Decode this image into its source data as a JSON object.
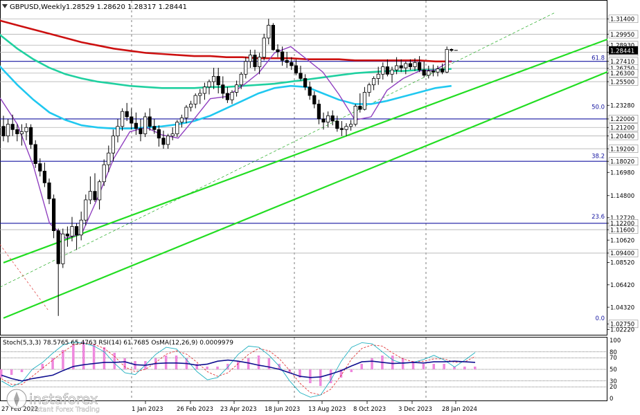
{
  "header": {
    "symbol": "GBPUSD,Weekly",
    "quote": "1.28529 1.28620 1.28317 1.28441"
  },
  "chart_data": {
    "type": "candlestick",
    "symbol": "GBPUSD",
    "timeframe": "Weekly",
    "price_axis_ticks": [
      "1.31400",
      "1.29950",
      "1.28930",
      "1.28270",
      "1.27410",
      "1.26750",
      "1.26300",
      "1.25500",
      "1.23280",
      "1.22000",
      "1.21200",
      "1.20400",
      "1.19200",
      "1.18020",
      "1.16980",
      "1.14800",
      "1.12720",
      "1.12200",
      "1.11600",
      "1.10620",
      "1.09400",
      "1.08520",
      "1.06420",
      "1.04320",
      "1.02750",
      "1.02220"
    ],
    "price_ylim": [
      1.0225,
      1.32
    ],
    "last_price": 1.28441,
    "time_axis_labels": [
      "27 Feb 2022",
      "1 Jan 2023",
      "26 Feb 2023",
      "23 Apr 2023",
      "18 Jun 2023",
      "13 Aug 2023",
      "8 Oct 2023",
      "3 Dec 2023",
      "28 Jan 2024"
    ],
    "horizontal_levels": [
      {
        "price": 1.314,
        "color": "#b0b0b0"
      },
      {
        "price": 1.2995,
        "color": "#b0b0b0"
      },
      {
        "price": 1.2893,
        "color": "#b0b0b0"
      },
      {
        "price": 1.2827,
        "color": "#b0b0b0"
      },
      {
        "price": 1.2741,
        "color": "#1515a0"
      },
      {
        "price": 1.2675,
        "color": "#b0b0b0"
      },
      {
        "price": 1.263,
        "color": "#b0b0b0"
      },
      {
        "price": 1.255,
        "color": "#b0b0b0"
      },
      {
        "price": 1.22,
        "color": "#1515a0"
      },
      {
        "price": 1.212,
        "color": "#b0b0b0"
      },
      {
        "price": 1.204,
        "color": "#b0b0b0"
      },
      {
        "price": 1.192,
        "color": "#b0b0b0"
      },
      {
        "price": 1.1802,
        "color": "#1515a0"
      },
      {
        "price": 1.122,
        "color": "#1515a0"
      },
      {
        "price": 1.116,
        "color": "#b0b0b0"
      },
      {
        "price": 1.094,
        "color": "#b0b0b0"
      }
    ],
    "fibonacci_labels": [
      {
        "label": "61.8",
        "price": 1.2741
      },
      {
        "label": "50.0",
        "price": 1.228
      },
      {
        "label": "38.2",
        "price": 1.182
      },
      {
        "label": "23.6",
        "price": 1.125
      },
      {
        "label": "0.0",
        "price": 1.0295
      }
    ],
    "moving_averages": [
      {
        "color": "#cc1010",
        "values": [
          1.316,
          1.312,
          1.308,
          1.304,
          1.3,
          1.296,
          1.292,
          1.289,
          1.286,
          1.284,
          1.282,
          1.281,
          1.28,
          1.279,
          1.279,
          1.278,
          1.278,
          1.277,
          1.277,
          1.277,
          1.276,
          1.276,
          1.276,
          1.275,
          1.275,
          1.275,
          1.275,
          1.275,
          1.274,
          1.274
        ]
      },
      {
        "color": "#20d0a0",
        "values": [
          1.312,
          1.298,
          1.286,
          1.276,
          1.268,
          1.262,
          1.258,
          1.255,
          1.253,
          1.251,
          1.25,
          1.249,
          1.249,
          1.249,
          1.25,
          1.25,
          1.251,
          1.252,
          1.253,
          1.255,
          1.257,
          1.259,
          1.261,
          1.263,
          1.264,
          1.265,
          1.265,
          1.266,
          1.266,
          1.267
        ]
      },
      {
        "color": "#20c8f0",
        "values": [
          1.284,
          1.268,
          1.252,
          1.238,
          1.226,
          1.219,
          1.214,
          1.212,
          1.211,
          1.211,
          1.212,
          1.213,
          1.215,
          1.218,
          1.223,
          1.23,
          1.237,
          1.244,
          1.249,
          1.251,
          1.25,
          1.244,
          1.238,
          1.234,
          1.234,
          1.237,
          1.241,
          1.245,
          1.249,
          1.251
        ]
      },
      {
        "color": "#9040c0",
        "values": [
          1.256,
          1.238,
          1.215,
          1.176,
          1.122,
          1.108,
          1.112,
          1.146,
          1.183,
          1.208,
          1.212,
          1.205,
          1.202,
          1.22,
          1.239,
          1.241,
          1.251,
          1.263,
          1.282,
          1.288,
          1.276,
          1.264,
          1.243,
          1.219,
          1.222,
          1.247,
          1.258,
          1.265,
          1.266,
          1.275
        ]
      }
    ],
    "channel_lines": [
      {
        "color": "#22dd22",
        "from": {
          "week": 0,
          "price": 1.085
        },
        "to": {
          "week": 148,
          "price": 1.32
        }
      },
      {
        "color": "#22dd22",
        "from": {
          "week": 0,
          "price": 1.033
        },
        "to": {
          "week": 148,
          "price": 1.292
        }
      }
    ],
    "candles": [
      {
        "o": 1.213,
        "h": 1.223,
        "l": 1.199,
        "c": 1.204
      },
      {
        "o": 1.204,
        "h": 1.22,
        "l": 1.198,
        "c": 1.215
      },
      {
        "o": 1.215,
        "h": 1.224,
        "l": 1.204,
        "c": 1.21
      },
      {
        "o": 1.21,
        "h": 1.215,
        "l": 1.199,
        "c": 1.206
      },
      {
        "o": 1.206,
        "h": 1.215,
        "l": 1.195,
        "c": 1.208
      },
      {
        "o": 1.208,
        "h": 1.216,
        "l": 1.2,
        "c": 1.212
      },
      {
        "o": 1.212,
        "h": 1.215,
        "l": 1.192,
        "c": 1.196
      },
      {
        "o": 1.196,
        "h": 1.2,
        "l": 1.174,
        "c": 1.178
      },
      {
        "o": 1.178,
        "h": 1.183,
        "l": 1.166,
        "c": 1.171
      },
      {
        "o": 1.171,
        "h": 1.179,
        "l": 1.156,
        "c": 1.16
      },
      {
        "o": 1.16,
        "h": 1.164,
        "l": 1.14,
        "c": 1.145
      },
      {
        "o": 1.145,
        "h": 1.149,
        "l": 1.108,
        "c": 1.115
      },
      {
        "o": 1.115,
        "h": 1.117,
        "l": 1.035,
        "c": 1.084
      },
      {
        "o": 1.084,
        "h": 1.117,
        "l": 1.08,
        "c": 1.112
      },
      {
        "o": 1.112,
        "h": 1.119,
        "l": 1.1,
        "c": 1.11
      },
      {
        "o": 1.11,
        "h": 1.128,
        "l": 1.105,
        "c": 1.119
      },
      {
        "o": 1.119,
        "h": 1.122,
        "l": 1.097,
        "c": 1.111
      },
      {
        "o": 1.111,
        "h": 1.133,
        "l": 1.106,
        "c": 1.125
      },
      {
        "o": 1.125,
        "h": 1.149,
        "l": 1.12,
        "c": 1.144
      },
      {
        "o": 1.144,
        "h": 1.166,
        "l": 1.14,
        "c": 1.152
      },
      {
        "o": 1.152,
        "h": 1.169,
        "l": 1.142,
        "c": 1.144
      },
      {
        "o": 1.144,
        "h": 1.163,
        "l": 1.135,
        "c": 1.161
      },
      {
        "o": 1.161,
        "h": 1.182,
        "l": 1.157,
        "c": 1.177
      },
      {
        "o": 1.177,
        "h": 1.195,
        "l": 1.17,
        "c": 1.188
      },
      {
        "o": 1.188,
        "h": 1.21,
        "l": 1.18,
        "c": 1.204
      },
      {
        "o": 1.204,
        "h": 1.22,
        "l": 1.198,
        "c": 1.213
      },
      {
        "o": 1.213,
        "h": 1.23,
        "l": 1.209,
        "c": 1.227
      },
      {
        "o": 1.227,
        "h": 1.235,
        "l": 1.218,
        "c": 1.222
      },
      {
        "o": 1.222,
        "h": 1.23,
        "l": 1.21,
        "c": 1.216
      },
      {
        "o": 1.216,
        "h": 1.226,
        "l": 1.205,
        "c": 1.211
      },
      {
        "o": 1.211,
        "h": 1.22,
        "l": 1.199,
        "c": 1.206
      },
      {
        "o": 1.206,
        "h": 1.226,
        "l": 1.203,
        "c": 1.222
      },
      {
        "o": 1.222,
        "h": 1.23,
        "l": 1.209,
        "c": 1.213
      },
      {
        "o": 1.213,
        "h": 1.22,
        "l": 1.206,
        "c": 1.21
      },
      {
        "o": 1.21,
        "h": 1.214,
        "l": 1.194,
        "c": 1.202
      },
      {
        "o": 1.202,
        "h": 1.209,
        "l": 1.192,
        "c": 1.196
      },
      {
        "o": 1.196,
        "h": 1.206,
        "l": 1.192,
        "c": 1.204
      },
      {
        "o": 1.204,
        "h": 1.212,
        "l": 1.2,
        "c": 1.206
      },
      {
        "o": 1.206,
        "h": 1.219,
        "l": 1.203,
        "c": 1.217
      },
      {
        "o": 1.217,
        "h": 1.224,
        "l": 1.212,
        "c": 1.221
      },
      {
        "o": 1.221,
        "h": 1.233,
        "l": 1.216,
        "c": 1.231
      },
      {
        "o": 1.231,
        "h": 1.237,
        "l": 1.227,
        "c": 1.234
      },
      {
        "o": 1.234,
        "h": 1.244,
        "l": 1.23,
        "c": 1.242
      },
      {
        "o": 1.242,
        "h": 1.248,
        "l": 1.234,
        "c": 1.244
      },
      {
        "o": 1.244,
        "h": 1.254,
        "l": 1.238,
        "c": 1.25
      },
      {
        "o": 1.25,
        "h": 1.257,
        "l": 1.243,
        "c": 1.255
      },
      {
        "o": 1.255,
        "h": 1.268,
        "l": 1.248,
        "c": 1.26
      },
      {
        "o": 1.26,
        "h": 1.268,
        "l": 1.244,
        "c": 1.252
      },
      {
        "o": 1.252,
        "h": 1.26,
        "l": 1.239,
        "c": 1.244
      },
      {
        "o": 1.244,
        "h": 1.25,
        "l": 1.235,
        "c": 1.238
      },
      {
        "o": 1.238,
        "h": 1.247,
        "l": 1.234,
        "c": 1.245
      },
      {
        "o": 1.245,
        "h": 1.256,
        "l": 1.241,
        "c": 1.252
      },
      {
        "o": 1.252,
        "h": 1.264,
        "l": 1.248,
        "c": 1.262
      },
      {
        "o": 1.262,
        "h": 1.278,
        "l": 1.258,
        "c": 1.274
      },
      {
        "o": 1.274,
        "h": 1.285,
        "l": 1.268,
        "c": 1.28
      },
      {
        "o": 1.28,
        "h": 1.285,
        "l": 1.265,
        "c": 1.269
      },
      {
        "o": 1.269,
        "h": 1.282,
        "l": 1.262,
        "c": 1.278
      },
      {
        "o": 1.278,
        "h": 1.3,
        "l": 1.275,
        "c": 1.296
      },
      {
        "o": 1.296,
        "h": 1.314,
        "l": 1.29,
        "c": 1.308
      },
      {
        "o": 1.308,
        "h": 1.31,
        "l": 1.284,
        "c": 1.285
      },
      {
        "o": 1.285,
        "h": 1.29,
        "l": 1.278,
        "c": 1.283
      },
      {
        "o": 1.283,
        "h": 1.288,
        "l": 1.27,
        "c": 1.275
      },
      {
        "o": 1.275,
        "h": 1.283,
        "l": 1.268,
        "c": 1.273
      },
      {
        "o": 1.273,
        "h": 1.278,
        "l": 1.266,
        "c": 1.27
      },
      {
        "o": 1.27,
        "h": 1.276,
        "l": 1.261,
        "c": 1.263
      },
      {
        "o": 1.263,
        "h": 1.27,
        "l": 1.256,
        "c": 1.258
      },
      {
        "o": 1.258,
        "h": 1.262,
        "l": 1.247,
        "c": 1.25
      },
      {
        "o": 1.25,
        "h": 1.255,
        "l": 1.238,
        "c": 1.242
      },
      {
        "o": 1.242,
        "h": 1.246,
        "l": 1.23,
        "c": 1.234
      },
      {
        "o": 1.234,
        "h": 1.238,
        "l": 1.215,
        "c": 1.22
      },
      {
        "o": 1.22,
        "h": 1.226,
        "l": 1.21,
        "c": 1.217
      },
      {
        "o": 1.217,
        "h": 1.227,
        "l": 1.212,
        "c": 1.223
      },
      {
        "o": 1.223,
        "h": 1.228,
        "l": 1.214,
        "c": 1.218
      },
      {
        "o": 1.218,
        "h": 1.223,
        "l": 1.208,
        "c": 1.211
      },
      {
        "o": 1.211,
        "h": 1.218,
        "l": 1.204,
        "c": 1.21
      },
      {
        "o": 1.21,
        "h": 1.216,
        "l": 1.204,
        "c": 1.213
      },
      {
        "o": 1.213,
        "h": 1.219,
        "l": 1.209,
        "c": 1.215
      },
      {
        "o": 1.215,
        "h": 1.234,
        "l": 1.213,
        "c": 1.232
      },
      {
        "o": 1.232,
        "h": 1.244,
        "l": 1.226,
        "c": 1.229
      },
      {
        "o": 1.229,
        "h": 1.25,
        "l": 1.228,
        "c": 1.245
      },
      {
        "o": 1.245,
        "h": 1.254,
        "l": 1.241,
        "c": 1.252
      },
      {
        "o": 1.252,
        "h": 1.26,
        "l": 1.247,
        "c": 1.258
      },
      {
        "o": 1.258,
        "h": 1.269,
        "l": 1.252,
        "c": 1.262
      },
      {
        "o": 1.262,
        "h": 1.273,
        "l": 1.257,
        "c": 1.269
      },
      {
        "o": 1.269,
        "h": 1.276,
        "l": 1.26,
        "c": 1.262
      },
      {
        "o": 1.262,
        "h": 1.269,
        "l": 1.254,
        "c": 1.266
      },
      {
        "o": 1.266,
        "h": 1.278,
        "l": 1.262,
        "c": 1.27
      },
      {
        "o": 1.27,
        "h": 1.276,
        "l": 1.264,
        "c": 1.268
      },
      {
        "o": 1.268,
        "h": 1.274,
        "l": 1.262,
        "c": 1.272
      },
      {
        "o": 1.272,
        "h": 1.276,
        "l": 1.266,
        "c": 1.269
      },
      {
        "o": 1.269,
        "h": 1.277,
        "l": 1.265,
        "c": 1.273
      },
      {
        "o": 1.273,
        "h": 1.279,
        "l": 1.264,
        "c": 1.266
      },
      {
        "o": 1.266,
        "h": 1.274,
        "l": 1.259,
        "c": 1.261
      },
      {
        "o": 1.261,
        "h": 1.27,
        "l": 1.258,
        "c": 1.265
      },
      {
        "o": 1.265,
        "h": 1.271,
        "l": 1.26,
        "c": 1.264
      },
      {
        "o": 1.264,
        "h": 1.27,
        "l": 1.26,
        "c": 1.267
      },
      {
        "o": 1.267,
        "h": 1.272,
        "l": 1.262,
        "c": 1.264
      },
      {
        "o": 1.264,
        "h": 1.288,
        "l": 1.263,
        "c": 1.2853
      },
      {
        "o": 1.2853,
        "h": 1.2862,
        "l": 1.2832,
        "c": 1.2844
      }
    ]
  },
  "oscillator": {
    "legend": "Stoch(5,3,3) 78.5765 65.4763  RSI(14) 61.7685  OsMA(12,26,9) 0.0009979",
    "axis_ticks": [
      "100",
      "80",
      "70",
      "50",
      "30",
      "20",
      "0"
    ],
    "levels": [
      80,
      70,
      50,
      30,
      20
    ],
    "rsi": [
      40,
      34,
      30,
      34,
      37,
      40,
      48,
      55,
      58,
      60,
      62,
      62,
      63,
      58,
      57,
      60,
      61,
      61,
      60,
      57,
      59,
      64,
      66,
      64,
      61,
      57,
      54,
      50,
      44,
      38,
      36,
      37,
      42,
      48,
      56,
      63,
      64,
      62,
      60,
      61,
      62,
      61,
      63,
      63,
      64,
      63,
      62
    ],
    "stoch_k": [
      30,
      20,
      28,
      50,
      62,
      78,
      92,
      97,
      95,
      90,
      80,
      60,
      44,
      41,
      58,
      76,
      88,
      85,
      66,
      46,
      32,
      36,
      54,
      76,
      90,
      88,
      74,
      55,
      30,
      10,
      2,
      6,
      32,
      64,
      88,
      96,
      94,
      80,
      66,
      60,
      62,
      67,
      74,
      66,
      54,
      66,
      79
    ],
    "stoch_d": [
      34,
      24,
      24,
      38,
      52,
      66,
      80,
      92,
      95,
      93,
      86,
      72,
      54,
      46,
      50,
      62,
      76,
      82,
      76,
      62,
      46,
      38,
      44,
      60,
      76,
      86,
      82,
      68,
      48,
      26,
      10,
      6,
      16,
      40,
      68,
      86,
      92,
      90,
      78,
      68,
      63,
      64,
      68,
      68,
      62,
      63,
      72
    ],
    "osma": [
      -3,
      -2,
      -1,
      0,
      2,
      4,
      7,
      9,
      10,
      9,
      8,
      6,
      4,
      3,
      3,
      4,
      5,
      5,
      4,
      2,
      1,
      1,
      2,
      3,
      4,
      5,
      4,
      2,
      -1,
      -3,
      -5,
      -6,
      -5,
      -3,
      -1,
      2,
      4,
      5,
      5,
      4,
      3,
      2,
      2,
      2,
      1,
      1,
      1
    ]
  },
  "watermark": {
    "brand": "instaforex",
    "tagline": "Instant Forex Trading"
  }
}
